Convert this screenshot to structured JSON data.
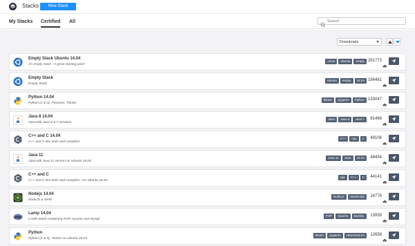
{
  "header": {
    "title": "Stacks",
    "new_stack_label": "New Stack"
  },
  "tabs": [
    {
      "label": "My Stacks",
      "active": false
    },
    {
      "label": "Certified",
      "active": true
    },
    {
      "label": "All",
      "active": false
    }
  ],
  "search": {
    "placeholder": "Search",
    "value": ""
  },
  "sort": {
    "selected": "Downloads",
    "accent_color": "#1e90ff"
  },
  "stacks": [
    {
      "name": "Empty Stack Ubuntu 14.04",
      "description": "An empty stack - A great starting point",
      "tags": [
        "Linux",
        "ubuntu",
        "empty"
      ],
      "count": "291773",
      "icon": "ubuntu-icon"
    },
    {
      "name": "Empty Stack",
      "description": "Empty Stack",
      "tags": [
        "ubuntu",
        "empty",
        "18.04"
      ],
      "count": "186481",
      "icon": "ubuntu-icon"
    },
    {
      "name": "Python 14.04",
      "description": "Python (2 & 3), PyGame, Tkinter",
      "tags": [
        "tkinter",
        "pygame",
        "Python"
      ],
      "count": "133047",
      "icon": "python-icon"
    },
    {
      "name": "Java 8 14.04",
      "description": "OpenJdk Java 8 & 7 versions",
      "tags": [
        "Java",
        "Java 8",
        "Java 7"
      ],
      "count": "81466",
      "icon": "java-icon"
    },
    {
      "name": "C++ and C 14.04",
      "description": "C++ and C dev tools and compilers",
      "tags": [
        "C++",
        "cpp",
        "C"
      ],
      "count": "49106",
      "icon": "cpp-icon"
    },
    {
      "name": "Java 11",
      "description": "OpenJdk Java 11 version on Ubuntu 18.04",
      "tags": [
        "Java 11",
        "Java",
        "18.04"
      ],
      "count": "48454",
      "icon": "java-icon"
    },
    {
      "name": "C++ and C",
      "description": "C++ and C dev tools and compilers. On Ubuntu 18.04",
      "tags": [
        "cpp",
        "C++",
        "C"
      ],
      "count": "44141",
      "icon": "cpp-icon"
    },
    {
      "name": "Nodejs 14.04",
      "description": "NodeJS & NPM",
      "tags": [
        "Node.js",
        "JavaScript"
      ],
      "count": "24776",
      "icon": "nodejs-icon"
    },
    {
      "name": "Lamp 14.04",
      "description": "LAMP Stack containing PHP, Apache and MySql",
      "tags": [
        "PHP",
        "Apache",
        "MySQL"
      ],
      "count": "13939",
      "icon": "php-icon"
    },
    {
      "name": "Python",
      "description": "Python (2 & 3), Tkinter on Ubuntu 18.04",
      "tags": [
        "tkinter",
        "pygame",
        "Ubuntu18.04"
      ],
      "count": "12658",
      "icon": "python-icon"
    }
  ]
}
